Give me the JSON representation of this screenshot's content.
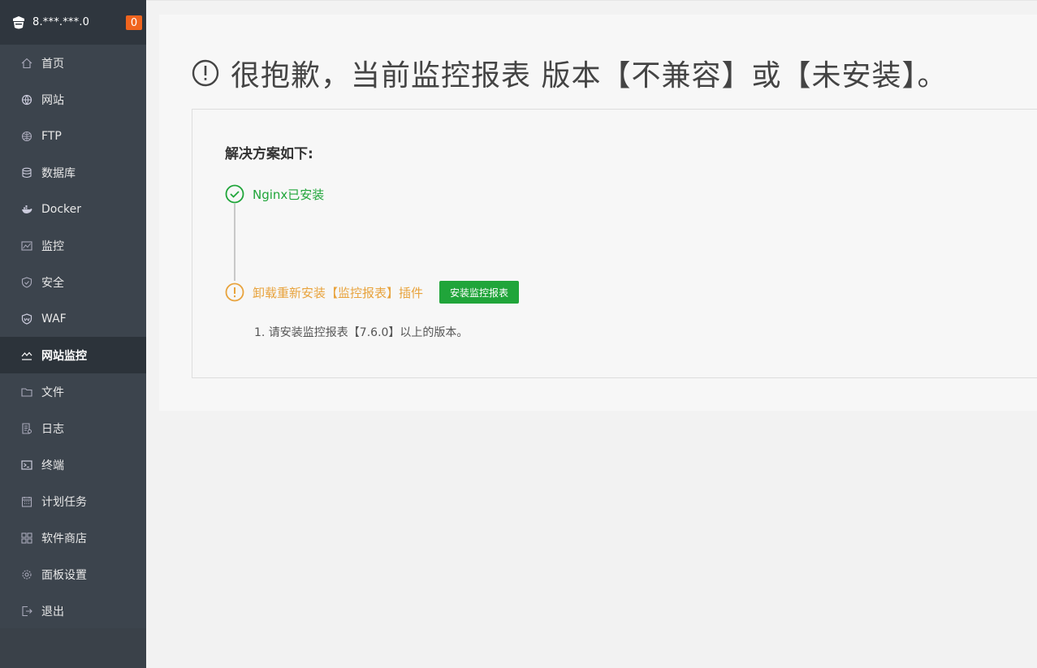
{
  "sidebar": {
    "server_name": "8.***.***.0",
    "badge_count": "0",
    "items": [
      {
        "label": "首页",
        "icon": "home-icon"
      },
      {
        "label": "网站",
        "icon": "globe-icon"
      },
      {
        "label": "FTP",
        "icon": "ftp-icon"
      },
      {
        "label": "数据库",
        "icon": "database-icon"
      },
      {
        "label": "Docker",
        "icon": "docker-icon"
      },
      {
        "label": "监控",
        "icon": "monitor-chart-icon"
      },
      {
        "label": "安全",
        "icon": "shield-icon"
      },
      {
        "label": "WAF",
        "icon": "waf-shield-icon"
      },
      {
        "label": "网站监控",
        "icon": "site-monitor-icon",
        "active": true
      },
      {
        "label": "文件",
        "icon": "folder-icon"
      },
      {
        "label": "日志",
        "icon": "log-icon"
      },
      {
        "label": "终端",
        "icon": "terminal-icon"
      },
      {
        "label": "计划任务",
        "icon": "calendar-icon"
      },
      {
        "label": "软件商店",
        "icon": "apps-grid-icon"
      },
      {
        "label": "面板设置",
        "icon": "gear-icon"
      },
      {
        "label": "退出",
        "icon": "logout-icon"
      }
    ]
  },
  "main": {
    "title": "很抱歉，当前监控报表 版本【不兼容】或【未安装】。",
    "solution_title": "解决方案如下:",
    "step1_text": "Nginx已安装",
    "step2_text": "卸载重新安装【监控报表】插件",
    "install_button": "安装监控报表",
    "note": "1. 请安装监控报表【7.6.0】以上的版本。"
  },
  "colors": {
    "sidebar_bg": "#3c444d",
    "success": "#20a53a",
    "warning": "#e8a33d",
    "badge": "#f0641e"
  }
}
